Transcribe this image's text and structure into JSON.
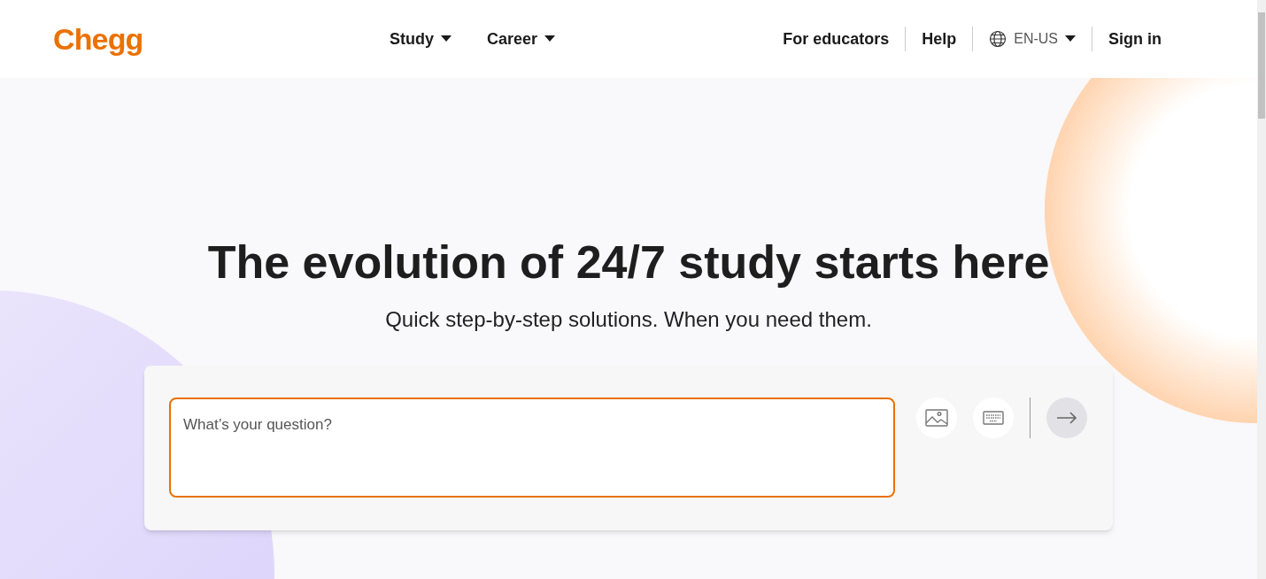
{
  "header": {
    "logo": "Chegg",
    "nav": [
      {
        "label": "Study",
        "caret": true
      },
      {
        "label": "Career",
        "caret": true
      }
    ],
    "links": [
      {
        "kind": "link",
        "label": "For educators"
      },
      {
        "kind": "link",
        "label": "Help"
      },
      {
        "kind": "language",
        "label": "EN-US"
      },
      {
        "kind": "link",
        "label": "Sign in"
      }
    ]
  },
  "hero": {
    "title": "The evolution of 24/7 study starts here",
    "subtitle": "Quick step-by-step solutions. When you need them.",
    "search": {
      "placeholder": "What’s your question?",
      "focused": true
    }
  }
}
